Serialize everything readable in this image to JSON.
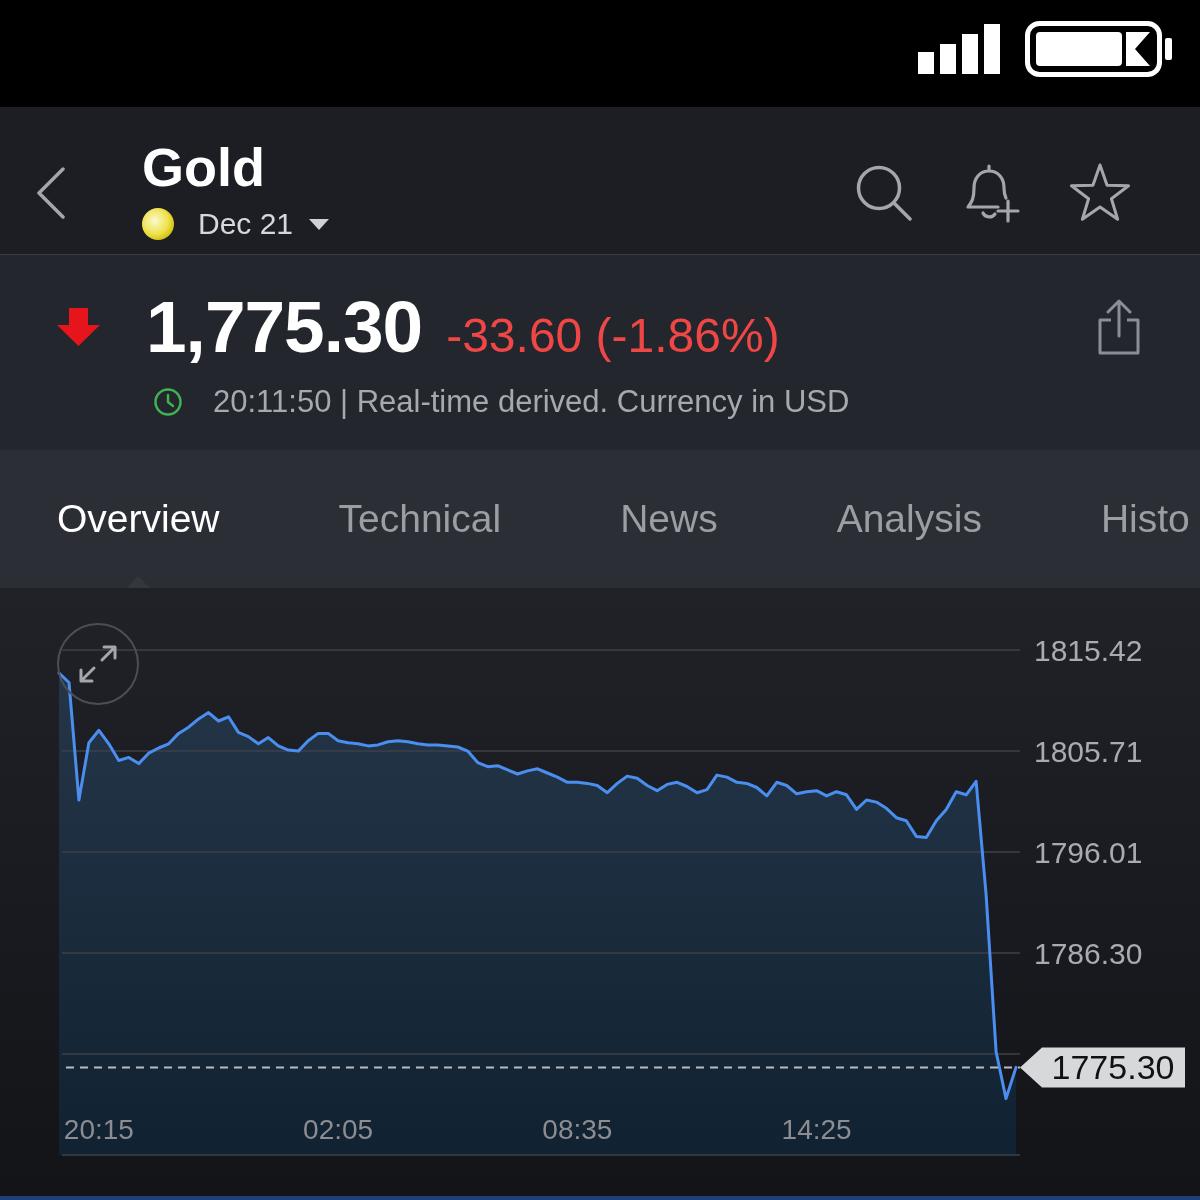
{
  "header": {
    "title": "Gold",
    "contract": "Dec 21"
  },
  "quote": {
    "price": "1,775.30",
    "change": "-33.60 (-1.86%)",
    "falling": true,
    "info": "20:11:50 | Real-time derived. Currency in USD"
  },
  "tabs": [
    {
      "label": "Overview",
      "selected": true
    },
    {
      "label": "Technical",
      "selected": false
    },
    {
      "label": "News",
      "selected": false
    },
    {
      "label": "Analysis",
      "selected": false
    },
    {
      "label": "Histo",
      "selected": false
    }
  ],
  "chart": {
    "chart_data": {
      "type": "area",
      "grid": true,
      "categories": [
        null,
        null,
        null,
        null,
        "20:15",
        null,
        null,
        null,
        null,
        null,
        null,
        null,
        null,
        null,
        null,
        null,
        null,
        null,
        null,
        null,
        null,
        null,
        null,
        null,
        null,
        null,
        null,
        null,
        "02:05",
        null,
        null,
        null,
        null,
        null,
        null,
        null,
        null,
        null,
        null,
        null,
        null,
        null,
        null,
        null,
        null,
        null,
        null,
        null,
        null,
        null,
        null,
        null,
        "08:35",
        null,
        null,
        null,
        null,
        null,
        null,
        null,
        null,
        null,
        null,
        null,
        null,
        null,
        null,
        null,
        null,
        null,
        null,
        null,
        null,
        null,
        null,
        null,
        "14:25",
        null,
        null,
        null,
        null,
        null,
        null,
        null,
        null,
        null,
        null,
        null,
        null,
        null,
        null,
        null,
        null,
        null,
        null,
        null,
        null
      ],
      "series": [
        {
          "color": "#4a8ef0",
          "values": [
            1813.2,
            1812.3,
            1801.0,
            1806.5,
            1807.7,
            1806.4,
            1804.8,
            1805.1,
            1804.5,
            1805.5,
            1806.0,
            1806.4,
            1807.4,
            1808.0,
            1808.8,
            1809.4,
            1808.6,
            1809.0,
            1807.5,
            1807.1,
            1806.4,
            1807.0,
            1806.2,
            1805.8,
            1805.7,
            1806.7,
            1807.4,
            1807.4,
            1806.7,
            1806.5,
            1806.4,
            1806.2,
            1806.3,
            1806.6,
            1806.7,
            1806.6,
            1806.4,
            1806.3,
            1806.3,
            1806.2,
            1806.1,
            1805.7,
            1804.6,
            1804.2,
            1804.3,
            1803.9,
            1803.5,
            1803.8,
            1804.0,
            1803.6,
            1803.2,
            1802.7,
            1802.7,
            1802.6,
            1802.4,
            1801.7,
            1802.6,
            1803.3,
            1803.1,
            1802.4,
            1801.9,
            1802.5,
            1802.7,
            1802.3,
            1801.7,
            1802.0,
            1803.4,
            1803.2,
            1802.7,
            1802.6,
            1802.2,
            1801.4,
            1802.7,
            1802.4,
            1801.6,
            1801.8,
            1801.9,
            1801.4,
            1801.8,
            1801.5,
            1800.1,
            1801.0,
            1800.8,
            1800.2,
            1799.3,
            1799.0,
            1797.5,
            1797.4,
            1799.0,
            1800.1,
            1801.8,
            1801.5,
            1802.8,
            1791.9,
            1776.8,
            1772.3,
            1775.3
          ]
        }
      ],
      "ylim": [
        1766.88,
        1815.42
      ],
      "yticks": [
        {
          "value": 1815.42,
          "label": "1815.42"
        },
        {
          "value": 1805.71,
          "label": "1805.71"
        },
        {
          "value": 1796.01,
          "label": "1796.01"
        },
        {
          "value": 1786.3,
          "label": "1786.30"
        }
      ],
      "ref_lines": [
        {
          "axis": "y",
          "value": 1775.3,
          "label": "1775.30"
        }
      ]
    }
  }
}
